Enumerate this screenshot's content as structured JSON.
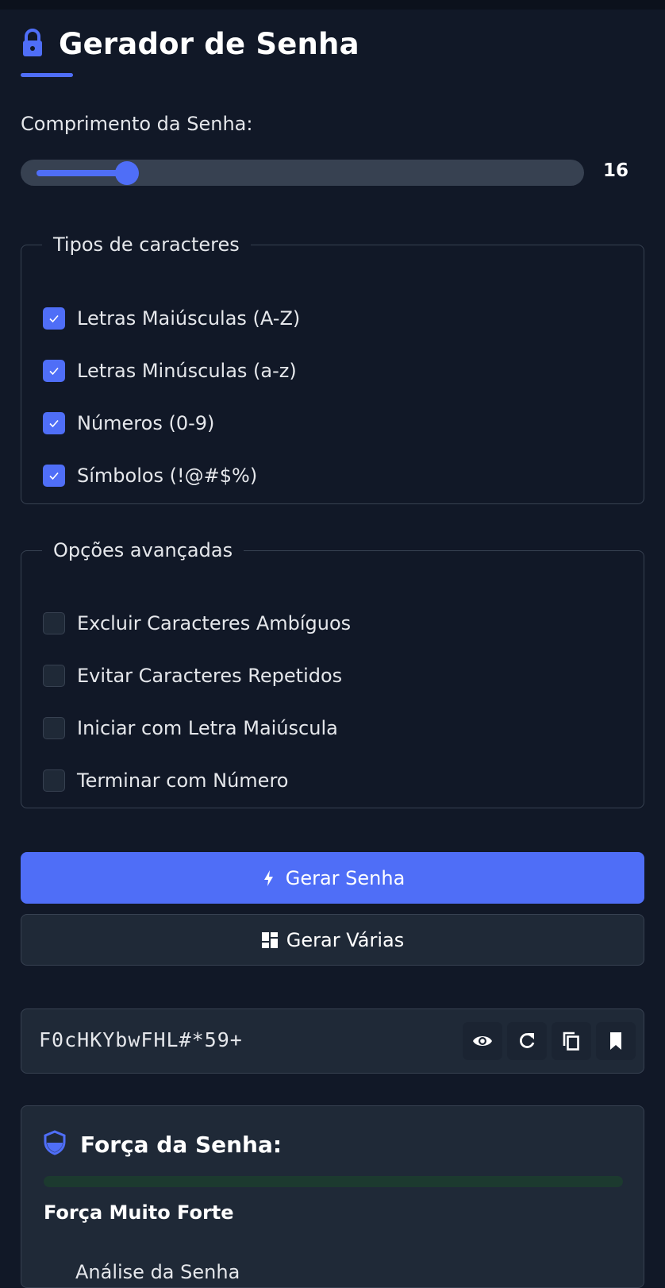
{
  "app": {
    "title": "Gerador de Senha",
    "accent_color": "#4f6ef7",
    "title_icon": "lock-icon"
  },
  "length": {
    "label": "Comprimento da Senha:",
    "value": "16",
    "slider_fraction": 0.14
  },
  "char_types": {
    "legend": "Tipos de caracteres",
    "options": [
      {
        "label": "Letras Maiúsculas (A-Z)",
        "checked": true
      },
      {
        "label": "Letras Minúsculas (a-z)",
        "checked": true
      },
      {
        "label": "Números (0-9)",
        "checked": true
      },
      {
        "label": "Símbolos (!@#$%)",
        "checked": true
      }
    ]
  },
  "advanced": {
    "legend": "Opções avançadas",
    "options": [
      {
        "label": "Excluir Caracteres Ambíguos",
        "checked": false
      },
      {
        "label": "Evitar Caracteres Repetidos",
        "checked": false
      },
      {
        "label": "Iniciar com Letra Maiúscula",
        "checked": false
      },
      {
        "label": "Terminar com Número",
        "checked": false
      }
    ]
  },
  "actions": {
    "generate_label": "Gerar Senha",
    "generate_icon": "bolt-icon",
    "generate_many_label": "Gerar Várias",
    "generate_many_icon": "grid-icon"
  },
  "output": {
    "password": "F0cHKYbwFHL#*59+",
    "icons": [
      "eye-icon",
      "refresh-icon",
      "copy-icon",
      "bookmark-icon"
    ]
  },
  "strength": {
    "title": "Força da Senha:",
    "icon": "shield-icon",
    "level_text": "Força Muito Forte",
    "bar_color": "#1c3a2f",
    "analysis_text": "Análise da Senha"
  }
}
